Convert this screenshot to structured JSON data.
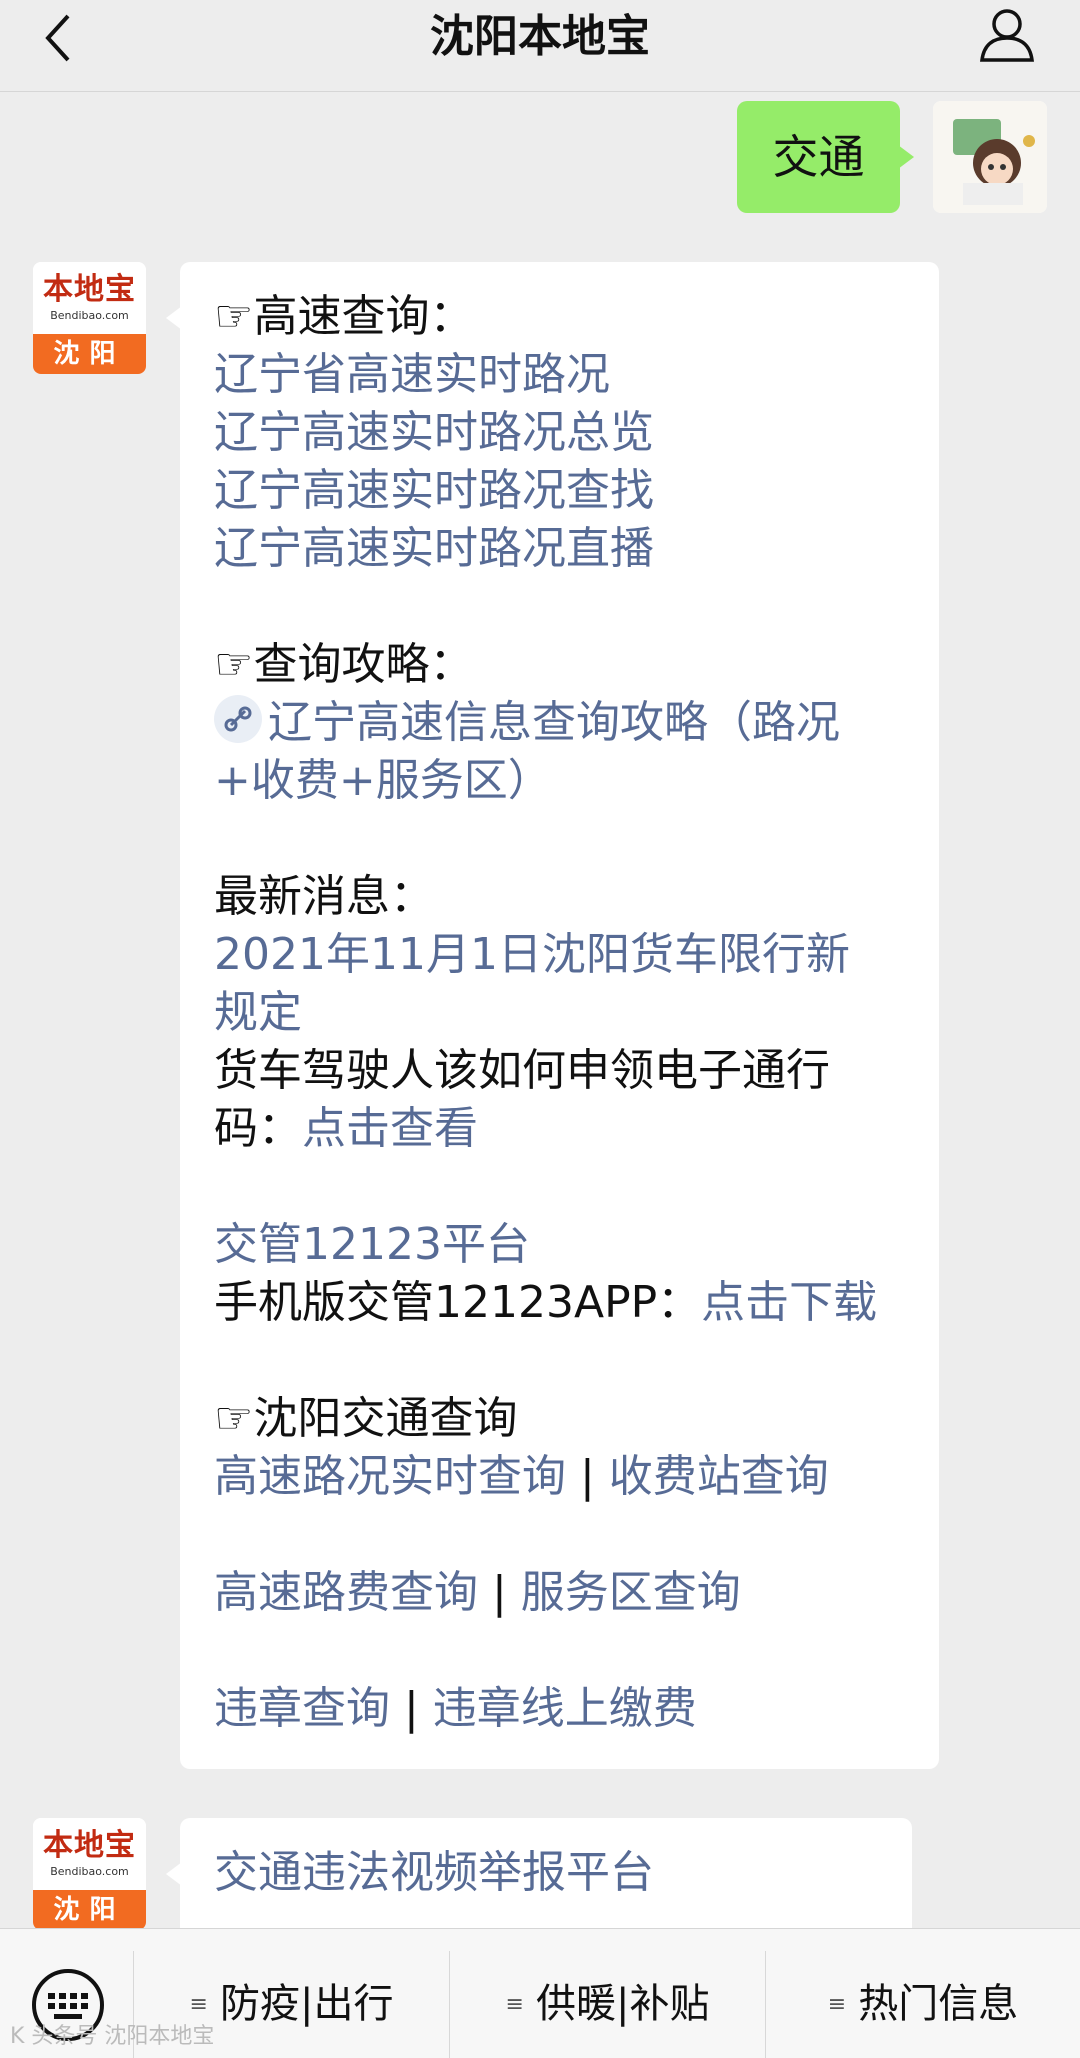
{
  "header": {
    "title": "沈阳本地宝"
  },
  "user_message": {
    "text": "交通"
  },
  "bot_avatar": {
    "brand": "本地宝",
    "domain": "Bendibao.com",
    "city": "沈阳"
  },
  "main_message": {
    "highway_heading": "☞高速查询：",
    "highway_links": [
      "辽宁省高速实时路况",
      "辽宁高速实时路况总览",
      "辽宁高速实时路况查找",
      "辽宁高速实时路况直播"
    ],
    "guide_heading": "☞查询攻略：",
    "guide_link_line1": "辽宁高速信息查询攻略（路况",
    "guide_link_line2": "+收费+服务区）",
    "news_heading": "最新消息：",
    "news_link_line1": "2021年11月1日沈阳货车限行新",
    "news_link_line2": "规定",
    "truck_text_line1": "货车驾驶人该如何申领电子通行",
    "truck_text_prefix": "码：",
    "truck_link": "点击查看",
    "platform_link": "交管12123平台",
    "app_text": "手机版交管12123APP：",
    "app_link": "点击下载",
    "traffic_heading": "☞沈阳交通查询",
    "row1_a": "高速路况实时查询",
    "row1_b": "收费站查询",
    "row2_a": "高速路费查询",
    "row2_b": "服务区查询",
    "row3_a": "违章查询",
    "row3_b": "违章线上缴费",
    "separator": " | "
  },
  "second_message": {
    "text": "交通违法视频举报平台"
  },
  "bottom_menu": {
    "items": [
      "防疫|出行",
      "供暖|补贴",
      "热门信息"
    ],
    "dash": "≡"
  },
  "watermark": "K 头条号 沈阳本地宝",
  "colors": {
    "link": "#576b95",
    "user_bubble": "#95ec69",
    "background": "#ededed"
  }
}
